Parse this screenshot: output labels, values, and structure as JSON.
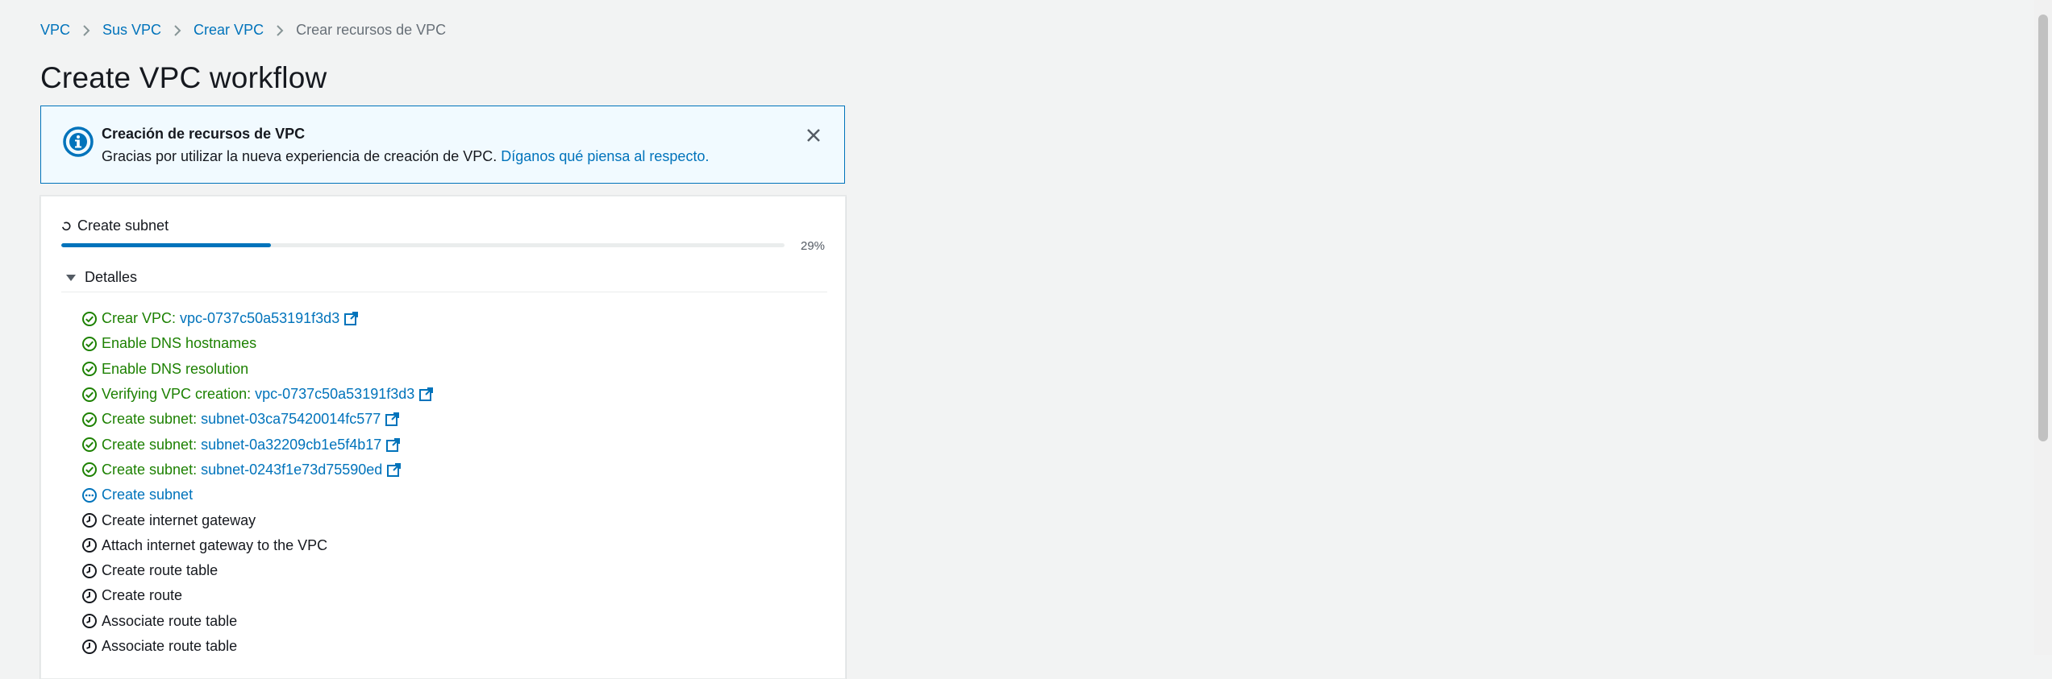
{
  "breadcrumb": {
    "items": [
      "VPC",
      "Sus VPC",
      "Crear VPC"
    ],
    "current": "Crear recursos de VPC"
  },
  "page": {
    "title": "Create VPC workflow"
  },
  "flash": {
    "title": "Creación de recursos de VPC",
    "body": "Gracias por utilizar la nueva experiencia de creación de VPC.",
    "link": "Díganos qué piensa al respecto."
  },
  "progress": {
    "label": "Create subnet",
    "percent_text": "29%",
    "value": 0.29
  },
  "details": {
    "label": "Detalles",
    "expanded": true
  },
  "steps": [
    {
      "status": "success",
      "text": "Crear VPC:",
      "link": "vpc-0737c50a53191f3d3",
      "external": true
    },
    {
      "status": "success",
      "text": "Enable DNS hostnames",
      "link": "",
      "external": false
    },
    {
      "status": "success",
      "text": "Enable DNS resolution",
      "link": "",
      "external": false
    },
    {
      "status": "success",
      "text": "Verifying VPC creation:",
      "link": "vpc-0737c50a53191f3d3",
      "external": true
    },
    {
      "status": "success",
      "text": "Create subnet:",
      "link": "subnet-03ca75420014fc577",
      "external": true
    },
    {
      "status": "success",
      "text": "Create subnet:",
      "link": "subnet-0a32209cb1e5f4b17",
      "external": true
    },
    {
      "status": "success",
      "text": "Create subnet:",
      "link": "subnet-0243f1e73d75590ed",
      "external": true
    },
    {
      "status": "in-progress",
      "text": "Create subnet",
      "link": "",
      "external": false
    },
    {
      "status": "pending",
      "text": "Create internet gateway",
      "link": "",
      "external": false
    },
    {
      "status": "pending",
      "text": "Attach internet gateway to the VPC",
      "link": "",
      "external": false
    },
    {
      "status": "pending",
      "text": "Create route table",
      "link": "",
      "external": false
    },
    {
      "status": "pending",
      "text": "Create route",
      "link": "",
      "external": false
    },
    {
      "status": "pending",
      "text": "Associate route table",
      "link": "",
      "external": false
    },
    {
      "status": "pending",
      "text": "Associate route table",
      "link": "",
      "external": false
    }
  ],
  "colors": {
    "link": "#0073bb",
    "success": "#1d8102",
    "info_border": "#0073bb",
    "info_bg": "#f1faff",
    "text": "#16191f"
  },
  "icons": {
    "flash": "info-circle-icon",
    "close": "close-icon",
    "success": "check-circle-icon",
    "in_progress": "in-progress-icon",
    "pending": "clock-icon",
    "external": "external-link-icon",
    "spinner": "spinner-icon",
    "caret": "caret-down-icon"
  }
}
